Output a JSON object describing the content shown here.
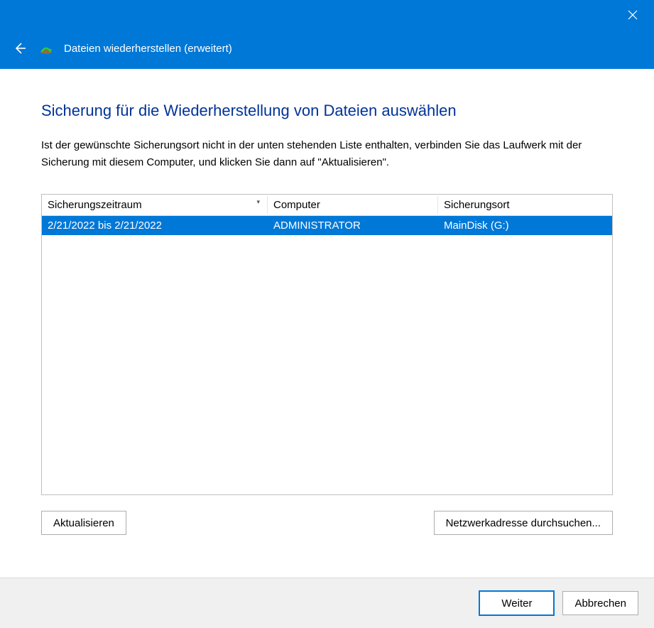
{
  "header": {
    "title": "Dateien wiederherstellen (erweitert)"
  },
  "page": {
    "title": "Sicherung für die Wiederherstellung von Dateien auswählen",
    "description": "Ist der gewünschte Sicherungsort nicht in der unten stehenden Liste enthalten, verbinden Sie das Laufwerk mit der Sicherung mit diesem Computer, und klicken Sie dann auf \"Aktualisieren\"."
  },
  "table": {
    "columns": {
      "period": "Sicherungszeitraum",
      "computer": "Computer",
      "location": "Sicherungsort"
    },
    "rows": [
      {
        "period": "2/21/2022 bis 2/21/2022",
        "computer": "ADMINISTRATOR",
        "location": "MainDisk (G:)",
        "selected": true
      }
    ]
  },
  "buttons": {
    "refresh": "Aktualisieren",
    "browse_network": "Netzwerkadresse durchsuchen...",
    "next": "Weiter",
    "cancel": "Abbrechen"
  }
}
